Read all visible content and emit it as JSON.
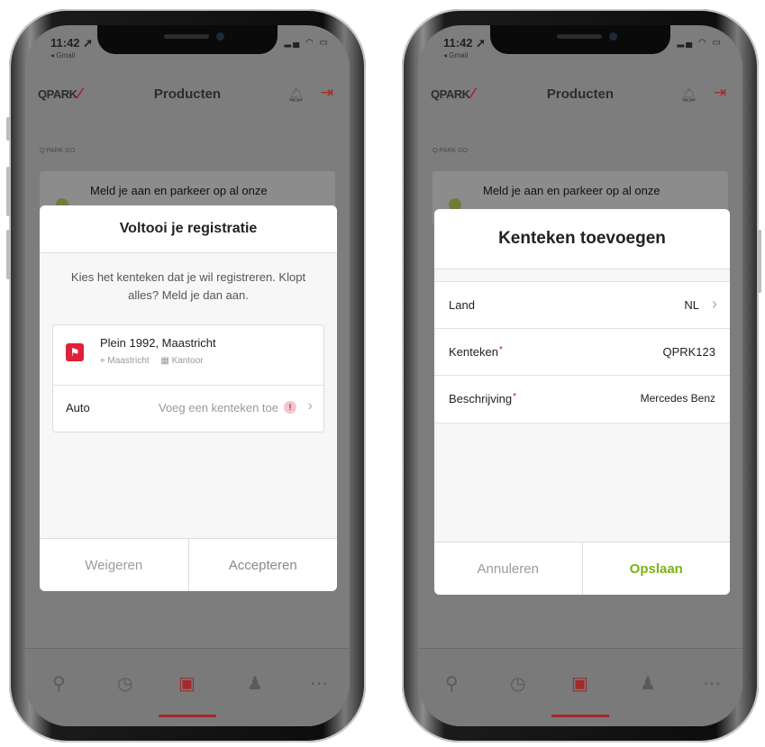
{
  "left": {
    "status_time": "11:42 ➚",
    "back_app": "◂ Gmail",
    "logo_text": "QPARK",
    "header_title": "Producten",
    "section_label": "Q-PARK GO",
    "promo_text": "Meld je aan en parkeer op al onze",
    "modal": {
      "title": "Voltooi je registratie",
      "description": "Kies het kenteken dat je wil registreren. Klopt alles? Meld je dan aan.",
      "location_name": "Plein 1992, Maastricht",
      "location_city": "Maastricht",
      "location_type": "Kantoor",
      "car_label": "Auto",
      "car_value": "Voeg een kenteken toe",
      "decline": "Weigeren",
      "accept": "Accepteren"
    }
  },
  "right": {
    "status_time": "11:42 ➚",
    "back_app": "◂ Gmail",
    "logo_text": "QPARK",
    "header_title": "Producten",
    "section_label": "Q-PARK GO",
    "promo_text": "Meld je aan en parkeer op al onze",
    "modal": {
      "title": "Kenteken toevoegen",
      "rows": [
        {
          "label": "Land",
          "value": "NL",
          "required": false
        },
        {
          "label": "Kenteken",
          "value": "QPRK123",
          "required": true
        },
        {
          "label": "Beschrijving",
          "value": "Mercedes Benz",
          "required": true
        }
      ],
      "cancel": "Annuleren",
      "save": "Opslaan"
    }
  },
  "colors": {
    "brand_red": "#b0162a",
    "accent_green": "#7ab317"
  }
}
